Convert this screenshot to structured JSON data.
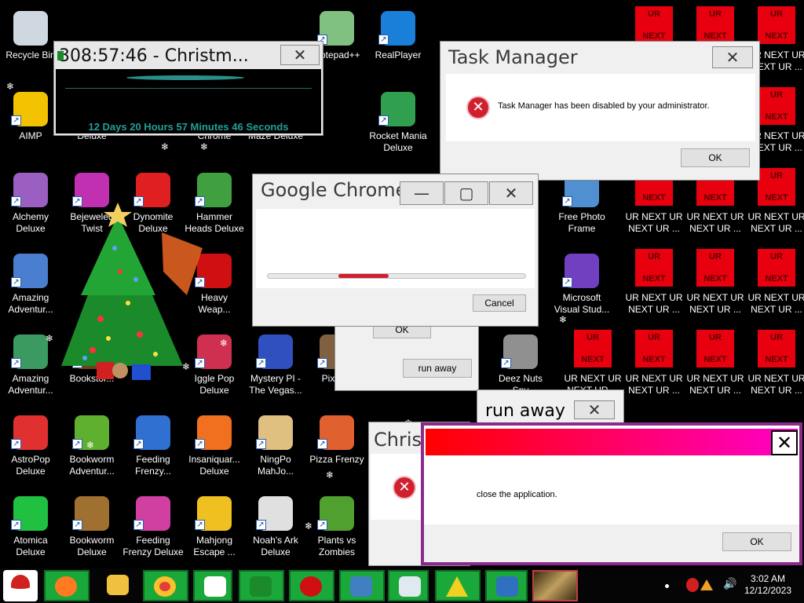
{
  "desktop": {
    "icons": [
      {
        "label": "Recycle Bin",
        "color": "#cfd8e0"
      },
      {
        "label": "AIMP",
        "color": "#f2c200"
      },
      {
        "label": "Alchemy\nDeluxe",
        "color": "#9a5fc0"
      },
      {
        "label": "Amazing\nAdventur...",
        "color": "#4a7fd0"
      },
      {
        "label": "Amazing\nAdventur...",
        "color": "#3a9a60"
      },
      {
        "label": "AstroPop\nDeluxe",
        "color": "#e03030"
      },
      {
        "label": "Atomica\nDeluxe",
        "color": "#20c040"
      },
      {
        "label": "Deluxe",
        "color": "#e04030"
      },
      {
        "label": "Bejeweled\nTwist",
        "color": "#c030b0"
      },
      {
        "label": "Bookstor...",
        "color": "#704020"
      },
      {
        "label": "Bookworm\nAdventur...",
        "color": "#60b030"
      },
      {
        "label": "Bookworm\nDeluxe",
        "color": "#a07030"
      },
      {
        "label": "Dynomite\nDeluxe",
        "color": "#e02020"
      },
      {
        "label": "Feeding\nFrenzy...",
        "color": "#3070d0"
      },
      {
        "label": "Feeding\nFrenzy Deluxe",
        "color": "#d040a0"
      },
      {
        "label": "Chrome",
        "color": "#ff7a00"
      },
      {
        "label": "Hammer\nHeads Deluxe",
        "color": "#40a040"
      },
      {
        "label": "Heavy\nWeap...",
        "color": "#d01010"
      },
      {
        "label": "Iggle Pop\nDeluxe",
        "color": "#d03050"
      },
      {
        "label": "Insaniquar...\nDeluxe",
        "color": "#f07020"
      },
      {
        "label": "Mahjong\nEscape ...",
        "color": "#f0c020"
      },
      {
        "label": "Maze Deluxe",
        "color": "#e04020"
      },
      {
        "label": "Mystery PI -\nThe Vegas...",
        "color": "#3050c0"
      },
      {
        "label": "NingPo\nMahJo...",
        "color": "#e0c080"
      },
      {
        "label": "Noah's Ark\nDeluxe",
        "color": "#e0e0e0"
      },
      {
        "label": "Pixelus",
        "color": "#806040"
      },
      {
        "label": "Pizza Frenzy",
        "color": "#e06030"
      },
      {
        "label": "Plants vs\nZombies",
        "color": "#50a030"
      },
      {
        "label": "Notepad++",
        "color": "#80c080"
      },
      {
        "label": "RealPlayer",
        "color": "#1a7fd8"
      },
      {
        "label": "Rocket Mania\nDeluxe",
        "color": "#30a050"
      },
      {
        "label": "Free Photo\nFrame",
        "color": "#5090d0"
      },
      {
        "label": "Microsoft\nVisual Stud...",
        "color": "#7040c0"
      },
      {
        "label": "Deez Nuts\nSpy",
        "color": "#909090"
      }
    ],
    "ur_top": "UR",
    "ur_bottom": "NEXT",
    "ur_label": "UR NEXT UR\nNEXT UR ...",
    "snowflake": "❄"
  },
  "timer_window": {
    "title": "308:57:46 - Christm...",
    "countdown": "12 Days 20 Hours 57 Minutes 46 Seconds"
  },
  "task_manager": {
    "title": "Task Manager",
    "message": "Task Manager has been disabled by your administrator.",
    "ok_label": "OK"
  },
  "chrome_dialog": {
    "title": "Google Chrome",
    "cancel_label": "Cancel",
    "progress": 0.4
  },
  "behind_dialog": {
    "ok_label": "OK",
    "run_away_label": "run away"
  },
  "run_away_window": {
    "title": "run away"
  },
  "christmas_dialog": {
    "title": "Chris"
  },
  "close_dialog": {
    "message": "close the application.",
    "ok_label": "OK"
  },
  "taskbar": {
    "time": "3:02 AM",
    "date": "12/12/2023"
  }
}
